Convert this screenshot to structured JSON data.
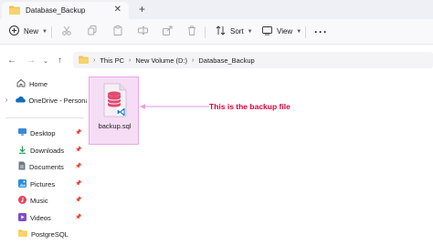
{
  "tab": {
    "title": "Database_Backup",
    "close_icon": "close-icon",
    "add_icon": "plus-icon"
  },
  "toolbar": {
    "new_label": "New",
    "sort_label": "Sort",
    "view_label": "View",
    "more_icon": "ellipsis-icon"
  },
  "address": {
    "crumbs": [
      "This PC",
      "New Volume (D:)",
      "Database_Backup"
    ]
  },
  "sidebar": {
    "home": "Home",
    "onedrive": "OneDrive - Persona",
    "desktop": "Desktop",
    "downloads": "Downloads",
    "documents": "Documents",
    "pictures": "Pictures",
    "music": "Music",
    "videos": "Videos",
    "postgresql": "PostgreSQL"
  },
  "file": {
    "name": "backup.sql"
  },
  "annotation": {
    "text": "This is the backup file",
    "color": "#e0003c"
  },
  "colors": {
    "selection_bg": "#f6ddf6",
    "selection_border": "#e6a9e6",
    "folder": "#f2c14e"
  }
}
